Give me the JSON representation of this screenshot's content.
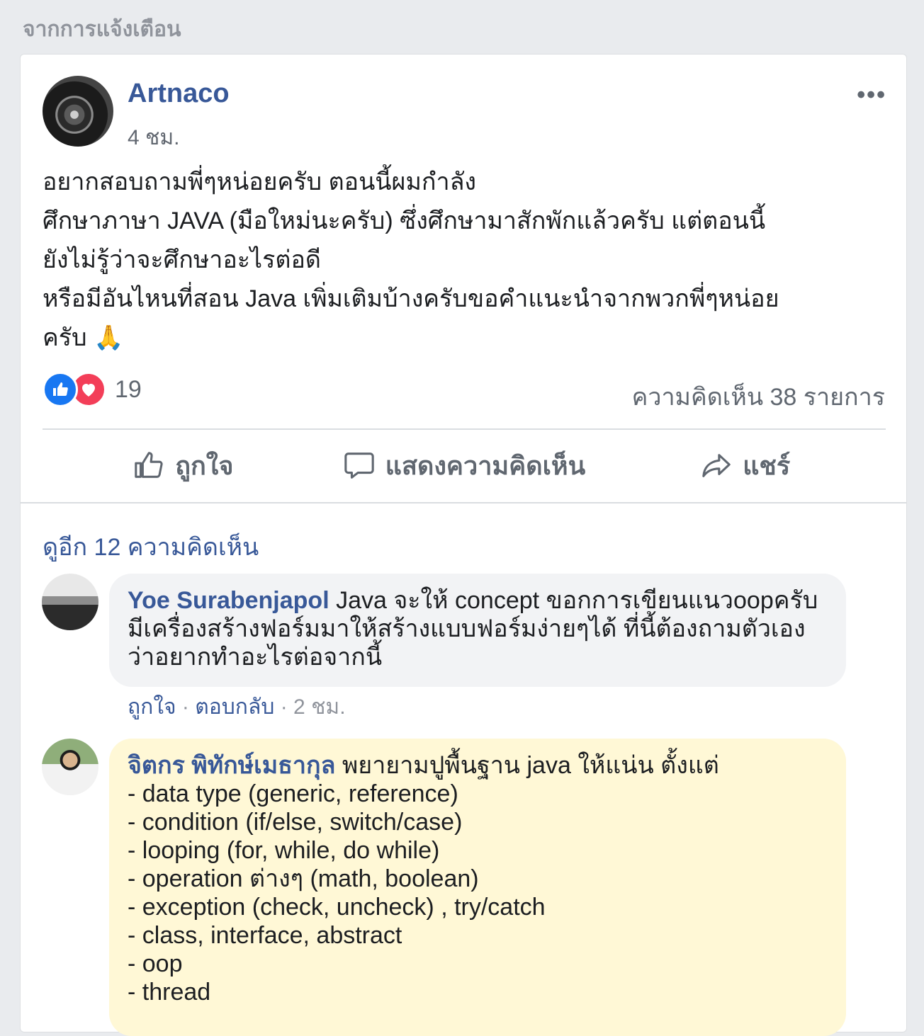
{
  "section_label": "จากการแจ้งเตือน",
  "post": {
    "author": "Artnaco",
    "time": "4 ชม.",
    "more_label": "•••",
    "text_lines": [
      "อยากสอบถามพี่ๆหน่อยครับ ตอนนี้ผมกำลัง",
      "ศึกษาภาษา JAVA (มือใหม่นะครับ) ซึ่งศึกษามาสักพักแล้วครับ แต่ตอนนี้",
      "ยังไม่รู้ว่าจะศึกษาอะไรต่อดี",
      "หรือมีอันไหนที่สอน Java เพิ่มเติมบ้างครับขอคำแนะนำจากพวกพี่ๆหน่อย",
      "ครับ"
    ],
    "emoji": "🙏",
    "reaction_count": "19",
    "comment_count": "ความคิดเห็น 38 รายการ"
  },
  "actions": {
    "like": "ถูกใจ",
    "comment": "แสดงความคิดเห็น",
    "share": "แชร์"
  },
  "comments_more": "ดูอีก 12 ความคิดเห็น",
  "comments": [
    {
      "name": "Yoe Surabenjapol",
      "text": " Java จะให้ concept ขอกการเขียนแนวoopครับ มีเครื่องสร้างฟอร์มมาให้สร้างแบบฟอร์มง่ายๆได้ ที่นี้ต้องถามตัวเองว่าอยากทำอะไรต่อจากนี้",
      "meta_like": "ถูกใจ",
      "meta_sep": " · ",
      "meta_reply": "ตอบกลับ",
      "meta_sep2": " · ",
      "meta_time": "2 ชม."
    },
    {
      "name": "จิตกร พิทักษ์เมธากุล",
      "intro": " พยายามปูพื้นฐาน java ให้แน่น ตั้งแต่",
      "items": [
        "- data type (generic, reference)",
        "- condition (if/else, switch/case)",
        "- looping (for, while, do while)",
        "- operation ต่างๆ (math, boolean)",
        "- exception (check, uncheck) , try/catch",
        "- class, interface, abstract",
        "- oop",
        "- thread"
      ]
    }
  ],
  "icons": {
    "like_reaction": "thumbs-up-icon",
    "love_reaction": "heart-icon",
    "like_action": "thumbs-up-outline-icon",
    "comment_action": "speech-bubble-icon",
    "share_action": "share-arrow-icon"
  },
  "colors": {
    "link_blue": "#385898",
    "like_blue": "#1877f2",
    "love_red": "#f33e58",
    "muted_text": "#606770",
    "highlight_bubble": "#fff8d6"
  }
}
